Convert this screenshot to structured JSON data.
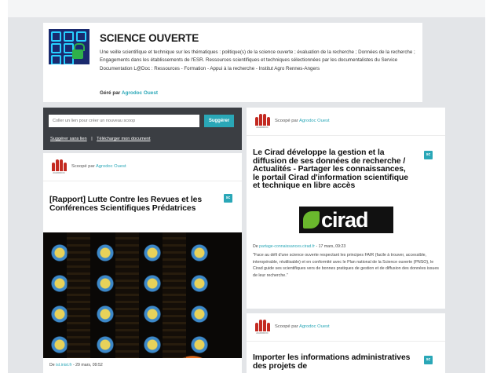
{
  "topic": {
    "title": "SCIENCE OUVERTE",
    "description": "Une veille scientifique et technique sur les thématiques : politique(s) de la science ouverte ; évaluation de la recherche ; Données de la recherche ; Engagements dans les établissements de l'ESR. Ressources scientifiques et techniques sélectionnées par les documentalistes du Service Documentation L@Doc : Ressources - Formation - Appui à la recherche - Institut Agro Rennes-Angers",
    "curator_prefix": "Géré par",
    "curator_name": "Agrodoc Ouest"
  },
  "suggest": {
    "placeholder": "Coller un lien pour créer un nouveau scoop",
    "button_label": "Suggérer",
    "no_link_label": "Suggérer sans lien",
    "separator": "|",
    "upload_label": "Télécharger mon document"
  },
  "posts": [
    {
      "curator_prefix": "Scoopé par",
      "curator_name": "Agrodoc Ouest",
      "scoop_icon": "scoopit-icon",
      "title": "[Rapport] Lutte Contre les Revues et les Conférences Scientifiques Prédatrices",
      "source_prefix": "De",
      "source_domain": "ist.inist.fr",
      "source_date": " - 29 mars, 09:52"
    },
    {
      "curator_prefix": "Scoopé par",
      "curator_name": "Agrodoc Ouest",
      "scoop_icon": "scoopit-icon",
      "title": "Le Cirad développe la gestion et la diffusion de ses données de recherche / Actualités - Partager les connaissances, le portail Cirad d'information scientifique et technique en libre accès",
      "image_label": "cirad",
      "source_prefix": "De",
      "source_domain": "partage-connaissances.cirad.fr",
      "source_date": " - 17 mars, 09:23",
      "excerpt": "\"Face au défi d'une science ouverte respectant les principes FAIR (facile à trouver, accessible, interopérable, réutilisable) et en conformité avec le Plan national de la Science ouverte (PNSO), le Cirad guide ses scientifiques vers de bonnes pratiques de gestion et de diffusion des données issues de leur recherche.\""
    },
    {
      "curator_prefix": "Scoopé par",
      "curator_name": "Agrodoc Ouest",
      "scoop_icon": "scoopit-icon",
      "title": "Importer les informations administratives des projets de"
    }
  ],
  "colors": {
    "accent": "#2aa7b7",
    "page_bg": "#e3e5e8",
    "suggest_bg": "#3b3e43",
    "avatar_red": "#c32a21"
  }
}
